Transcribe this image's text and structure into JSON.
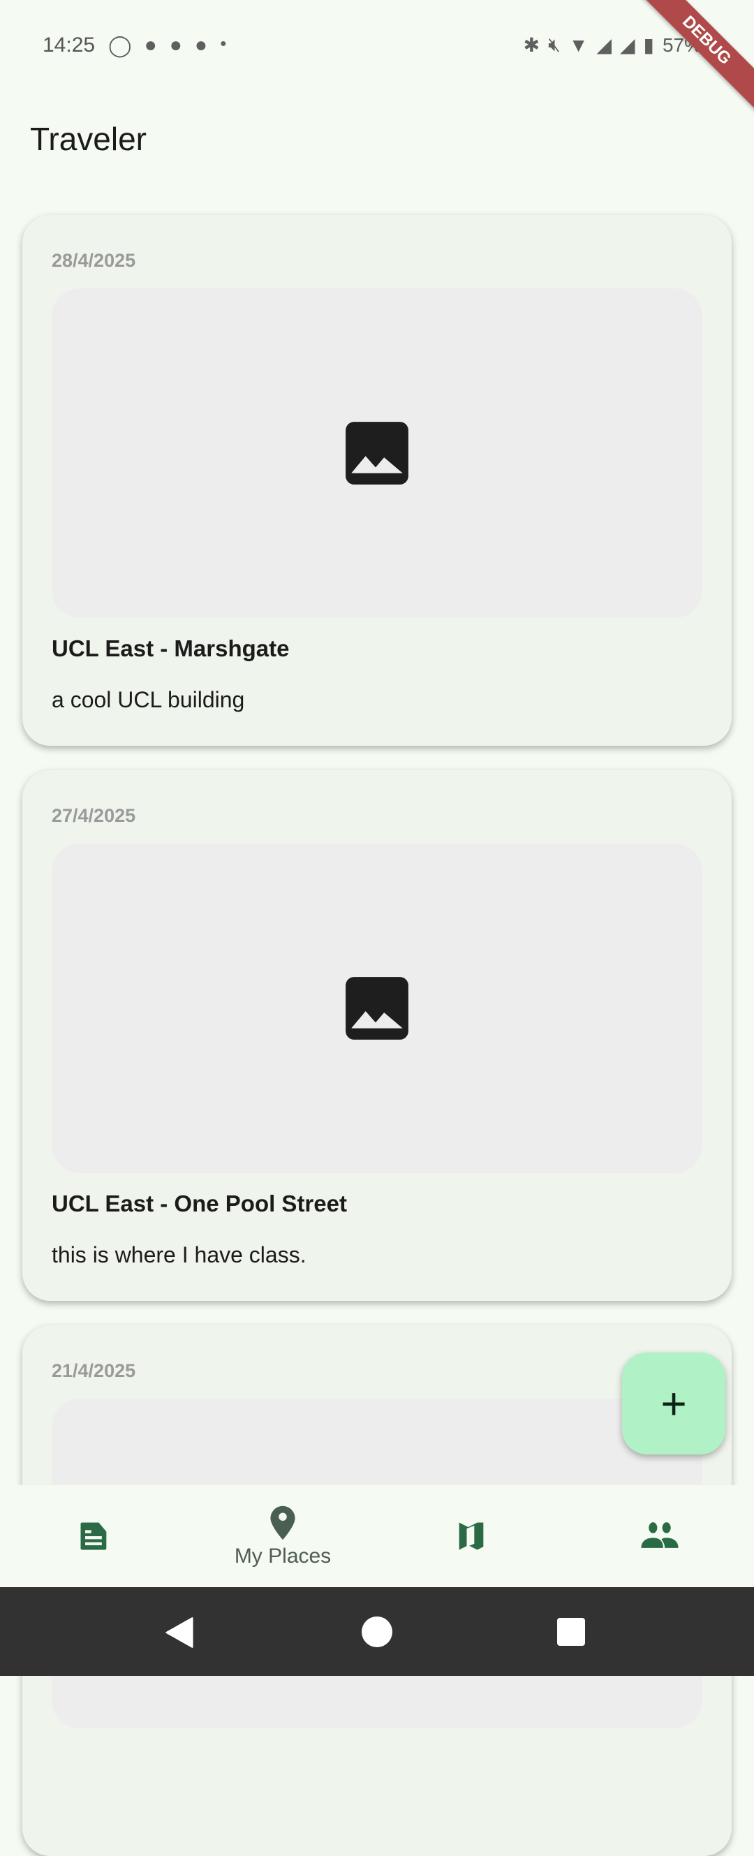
{
  "status": {
    "time": "14:25",
    "battery": "57%",
    "debug": "DEBUG"
  },
  "app": {
    "title": "Traveler"
  },
  "cards": [
    {
      "date": "28/4/2025",
      "title": "UCL East - Marshgate",
      "description": "a cool UCL building"
    },
    {
      "date": "27/4/2025",
      "title": "UCL East - One Pool Street",
      "description": "this is where I have class."
    },
    {
      "date": "21/4/2025",
      "title": "",
      "description": ""
    }
  ],
  "fab": {
    "label": "+"
  },
  "nav": {
    "items": [
      {
        "icon": "article-icon",
        "label": ""
      },
      {
        "icon": "place-icon",
        "label": "My Places"
      },
      {
        "icon": "map-icon",
        "label": ""
      },
      {
        "icon": "people-icon",
        "label": ""
      }
    ]
  },
  "colors": {
    "accent": "#2a6b45",
    "fab": "#b0f2c6",
    "background": "#f5faf2"
  }
}
